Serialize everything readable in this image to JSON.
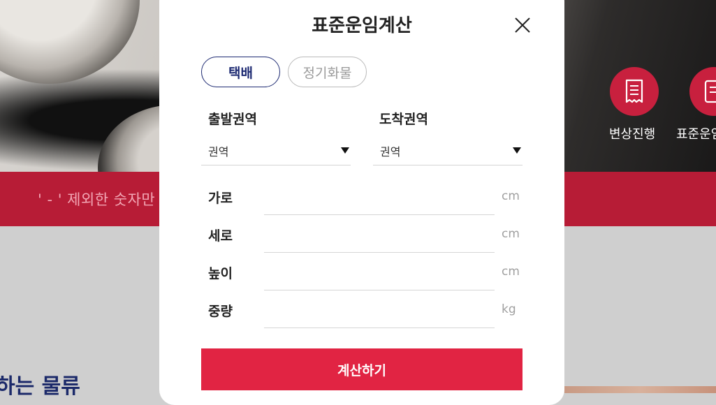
{
  "background": {
    "banner_text": "' - ' 제외한 숫자만",
    "heading_partial": "하는 물류",
    "quick_menu": [
      {
        "icon": "receipt-icon",
        "label": "변상진행"
      },
      {
        "icon": "document-icon",
        "label": "표준운임계산"
      }
    ],
    "accent_color": "#c8203e",
    "banner_color": "#b71c36"
  },
  "modal": {
    "title": "표준운임계산",
    "close_icon": "close-icon",
    "tabs": [
      {
        "label": "택배",
        "active": true
      },
      {
        "label": "정기화물",
        "active": false
      }
    ],
    "departure": {
      "label": "출발권역",
      "selected": "권역"
    },
    "arrival": {
      "label": "도착권역",
      "selected": "권역"
    },
    "fields": [
      {
        "label": "가로",
        "value": "",
        "unit": "cm"
      },
      {
        "label": "세로",
        "value": "",
        "unit": "cm"
      },
      {
        "label": "높이",
        "value": "",
        "unit": "cm"
      },
      {
        "label": "중량",
        "value": "",
        "unit": "kg"
      }
    ],
    "submit_label": "계산하기",
    "colors": {
      "active_tab": "#1d2a72",
      "submit": "#e12443"
    }
  }
}
